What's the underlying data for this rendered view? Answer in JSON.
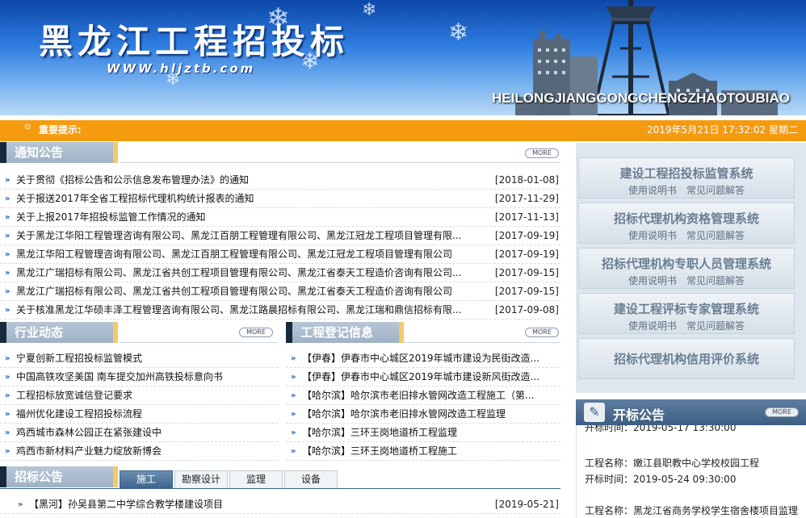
{
  "banner": {
    "title": "黑龙江工程招投标",
    "url": "WWW.hljztb.com",
    "pinyin": "HEILONGJIANGGONGCHENGZHAOTOUBIAO"
  },
  "notice_bar": {
    "tip_label": "重要提示:",
    "datetime": "2019年5月21日  17:32:02 星期二"
  },
  "announcements": {
    "title": "通知公告",
    "more": "MORE",
    "items": [
      {
        "text": "关于贯彻《招标公告和公示信息发布管理办法》的通知",
        "date": "[2018-01-08]"
      },
      {
        "text": "关于报送2017年全省工程招标代理机构统计报表的通知",
        "date": "[2017-11-29]"
      },
      {
        "text": "关于上报2017年招投标监管工作情况的通知",
        "date": "[2017-11-13]"
      },
      {
        "text": "关于黑龙江华阳工程管理咨询有限公司、黑龙江百朋工程管理有限公司、黑龙江冠龙工程项目管理有限...",
        "date": "[2017-09-19]"
      },
      {
        "text": "黑龙江华阳工程管理咨询有限公司、黑龙江百朋工程管理有限公司、黑龙江冠龙工程项目管理有限公司",
        "date": "[2017-09-19]"
      },
      {
        "text": "黑龙江广瑞招标有限公司、黑龙江省共创工程项目管理有限公司、黑龙江省泰天工程造价咨询有限公司...",
        "date": "[2017-09-15]"
      },
      {
        "text": "黑龙江广瑞招标有限公司、黑龙江省共创工程项目管理有限公司、黑龙江省泰天工程造价咨询有限公司",
        "date": "[2017-09-15]"
      },
      {
        "text": "关于核准黑龙江华硕丰泽工程管理咨询有限公司、黑龙江路晨招标有限公司、黑龙江瑞和鼎信招标有限...",
        "date": "[2017-09-08]"
      }
    ]
  },
  "industry": {
    "title": "行业动态",
    "more": "MORE",
    "items": [
      "宁夏创新工程招投标监管模式",
      "中国高铁攻坚美国 南车提交加州高铁投标意向书",
      "工程招标放宽诚信登记要求",
      "福州优化建设工程招投标流程",
      "鸡西城市森林公园正在紧张建设中",
      "鸡西市新材料产业魅力绽放新博会"
    ]
  },
  "registration": {
    "title": "工程登记信息",
    "more": "MORE",
    "items": [
      "【伊春】伊春市中心城区2019年城市建设为民街改造...",
      "【伊春】伊春市中心城区2019年城市建设新风街改造...",
      "【哈尔滨】哈尔滨市老旧排水管网改造工程施工（第...",
      "【哈尔滨】哈尔滨市老旧排水管网改造工程监理",
      "【哈尔滨】三环王岗地道桥工程监理",
      "【哈尔滨】三环王岗地道桥工程施工"
    ]
  },
  "tender": {
    "title": "招标公告",
    "tabs": [
      "施工",
      "勘察设计",
      "监理",
      "设备"
    ],
    "items": [
      {
        "text": "【黑河】孙吴县第二中学综合教学楼建设项目",
        "date": "[2019-05-21]"
      }
    ]
  },
  "systems": [
    {
      "name": "建设工程招投标监管系统",
      "links": [
        "使用说明书",
        "常见问题解答"
      ]
    },
    {
      "name": "招标代理机构资格管理系统",
      "links": [
        "使用说明书",
        "常见问题解答"
      ]
    },
    {
      "name": "招标代理机构专职人员管理系统",
      "links": [
        "使用说明书",
        "常见问题解答"
      ]
    },
    {
      "name": "建设工程评标专家管理系统",
      "links": [
        "使用说明书",
        "常见问题解答"
      ]
    },
    {
      "name": "招标代理机构信用评价系统",
      "links": []
    }
  ],
  "bid_opening": {
    "title": "开标公告",
    "more": "MORE",
    "rows": [
      "开标时间：2019-05-17 13:30:00",
      "工程名称：嫩江县职教中心学校校园工程",
      "开标时间：2019-05-24 09:30:00",
      "工程名称：黑龙江省商务学校学生宿舍楼项目监理"
    ]
  },
  "colors": {
    "accent_orange": "#f59b10",
    "header_blue": "#3c5e82",
    "link_blue": "#1b5fb5"
  }
}
